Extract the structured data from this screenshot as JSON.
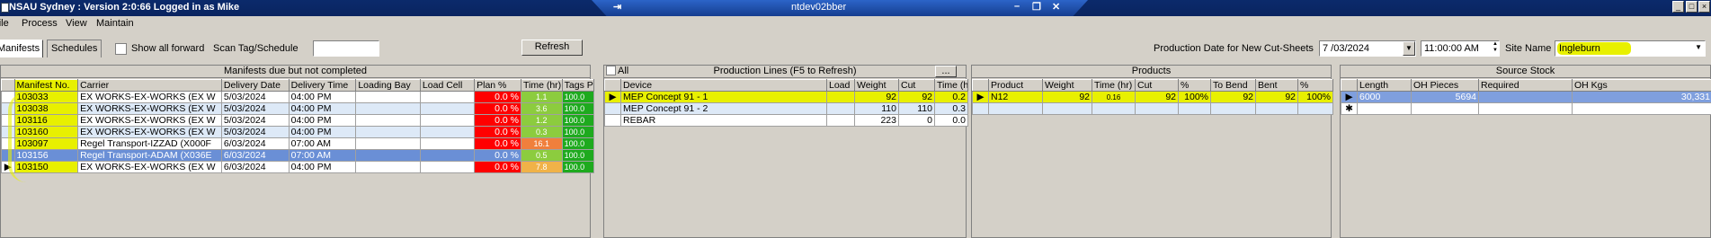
{
  "window": {
    "title": "NSAU Sydney : Version 2:0:66 Logged in as Mike",
    "remote_host": "ntdev02bber",
    "remote_buttons": [
      "–",
      "❐",
      "✕"
    ],
    "win_buttons": [
      "_",
      "□",
      "×"
    ]
  },
  "menu": [
    "File",
    "Process",
    "View",
    "Maintain"
  ],
  "toolbar": {
    "tabs": [
      "Manifests",
      "Schedules"
    ],
    "show_all_forward": "Show all forward",
    "scan_label": "Scan Tag/Schedule",
    "scan_value": "",
    "refresh": "Refresh",
    "prod_date_label": "Production Date for New Cut-Sheets",
    "prod_date": "7 /03/2024",
    "prod_time": "11:00:00 AM",
    "site_label": "Site Name",
    "site_value": "Ingleburn"
  },
  "manifests": {
    "caption": "Manifests due but not completed",
    "headers": [
      "Manifest No.",
      "Carrier",
      "Delivery Date",
      "Delivery Time",
      "Loading Bay",
      "Load Cell",
      "Plan %",
      "Time (hr)",
      "Tags Prin"
    ],
    "rows": [
      {
        "no": "103033",
        "carrier": "EX WORKS-EX-WORKS (EX W",
        "date": "5/03/2024",
        "time": "04:00 PM",
        "bay": "",
        "cell": "",
        "plan": "0.0 %",
        "hr": "1.1",
        "tags": "100.0",
        "style": "a",
        "hrc": "green"
      },
      {
        "no": "103038",
        "carrier": "EX WORKS-EX-WORKS (EX W",
        "date": "5/03/2024",
        "time": "04:00 PM",
        "bay": "",
        "cell": "",
        "plan": "0.0 %",
        "hr": "3.6",
        "tags": "100.0",
        "style": "b",
        "hrc": "green"
      },
      {
        "no": "103116",
        "carrier": "EX WORKS-EX-WORKS (EX W",
        "date": "5/03/2024",
        "time": "04:00 PM",
        "bay": "",
        "cell": "",
        "plan": "0.0 %",
        "hr": "1.2",
        "tags": "100.0",
        "style": "a",
        "hrc": "green"
      },
      {
        "no": "103160",
        "carrier": "EX WORKS-EX-WORKS (EX W",
        "date": "5/03/2024",
        "time": "04:00 PM",
        "bay": "",
        "cell": "",
        "plan": "0.0 %",
        "hr": "0.3",
        "tags": "100.0",
        "style": "b",
        "hrc": "green"
      },
      {
        "no": "103097",
        "carrier": "Regel Transport-IZZAD (X000F",
        "date": "6/03/2024",
        "time": "07:00 AM",
        "bay": "",
        "cell": "",
        "plan": "0.0 %",
        "hr": "16.1",
        "tags": "100.0",
        "style": "a",
        "hrc": "orange"
      },
      {
        "no": "103156",
        "carrier": "Regel Transport-ADAM (X036E",
        "date": "6/03/2024",
        "time": "07:00 AM",
        "bay": "",
        "cell": "",
        "plan": "0.0 %",
        "hr": "0.5",
        "tags": "100.0",
        "style": "sel",
        "hrc": "green"
      },
      {
        "no": "103150",
        "carrier": "EX WORKS-EX-WORKS (EX W",
        "date": "6/03/2024",
        "time": "04:00 PM",
        "bay": "",
        "cell": "",
        "plan": "0.0 %",
        "hr": "7.8",
        "tags": "100.0",
        "style": "a",
        "hrc": "amber"
      }
    ]
  },
  "production_lines": {
    "caption": "Production Lines (F5 to Refresh)",
    "all_label": "All",
    "more": "...",
    "headers": [
      "Device",
      "Load",
      "Weight",
      "Cut",
      "Time (hr"
    ],
    "rows": [
      {
        "device": "MEP Concept 91 - 1",
        "load": "",
        "weight": "92",
        "cut": "92",
        "time": "0.2"
      },
      {
        "device": "MEP Concept 91 - 2",
        "load": "",
        "weight": "110",
        "cut": "110",
        "time": "0.3"
      },
      {
        "device": "REBAR",
        "load": "",
        "weight": "223",
        "cut": "0",
        "time": "0.0"
      }
    ]
  },
  "products": {
    "caption": "Products",
    "headers": [
      "Product",
      "Weight",
      "Time (hr)",
      "Cut",
      "%",
      "To Bend",
      "Bent",
      "%"
    ],
    "rows": [
      {
        "product": "N12",
        "weight": "92",
        "time": "0.16",
        "cut": "92",
        "pct": "100%",
        "to_bend": "92",
        "bent": "92",
        "pct2": "100%"
      }
    ]
  },
  "source_stock": {
    "caption": "Source Stock",
    "headers": [
      "Length",
      "OH Pieces",
      "Required",
      "OH Kgs"
    ],
    "rows": [
      {
        "length": "6000",
        "oh_pieces": "5694",
        "required": "",
        "oh_kgs": "30,331"
      }
    ],
    "new_row_marker": "✱"
  }
}
